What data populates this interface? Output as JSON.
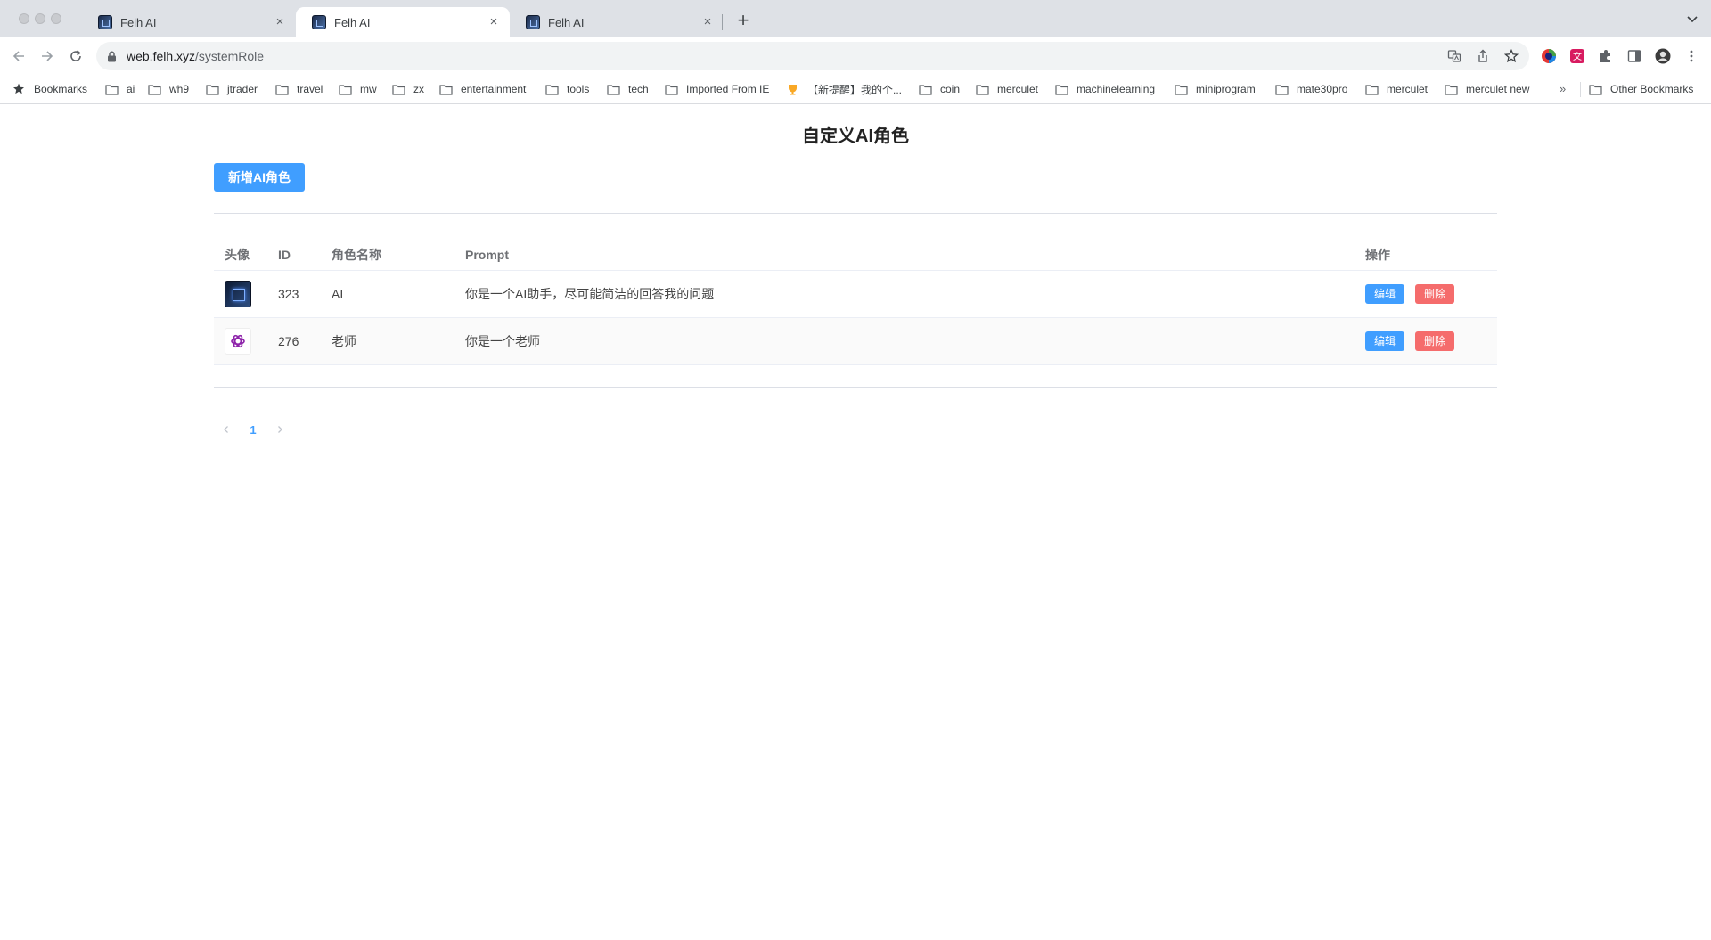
{
  "browser": {
    "tabs": [
      {
        "title": "Felh AI",
        "active": false
      },
      {
        "title": "Felh AI",
        "active": true
      },
      {
        "title": "Felh AI",
        "active": false
      }
    ],
    "url_host": "web.felh.xyz",
    "url_path": "/systemRole"
  },
  "bookmarks": {
    "label": "Bookmarks",
    "items": [
      "ai",
      "wh9",
      "jtrader",
      "travel",
      "mw",
      "zx",
      "entertainment",
      "tools",
      "tech",
      "Imported From IE",
      "【新提醒】我的个...",
      "coin",
      "merculet",
      "machinelearning",
      "miniprogram",
      "mate30pro",
      "merculet",
      "merculet new"
    ],
    "more": "»",
    "other": "Other Bookmarks"
  },
  "page": {
    "title": "自定义AI角色",
    "add_button": "新增AI角色",
    "columns": {
      "avatar": "头像",
      "id": "ID",
      "name": "角色名称",
      "prompt": "Prompt",
      "ops": "操作"
    },
    "rows": [
      {
        "avatar": "chip-icon",
        "id": "323",
        "name": "AI",
        "prompt": "你是一个AI助手，尽可能简洁的回答我的问题"
      },
      {
        "avatar": "openai-logo-icon",
        "id": "276",
        "name": "老师",
        "prompt": "你是一个老师"
      }
    ],
    "edit_label": "编辑",
    "delete_label": "删除",
    "pagination": {
      "current": "1"
    }
  },
  "colors": {
    "primary": "#409eff",
    "danger": "#f56c6c"
  }
}
